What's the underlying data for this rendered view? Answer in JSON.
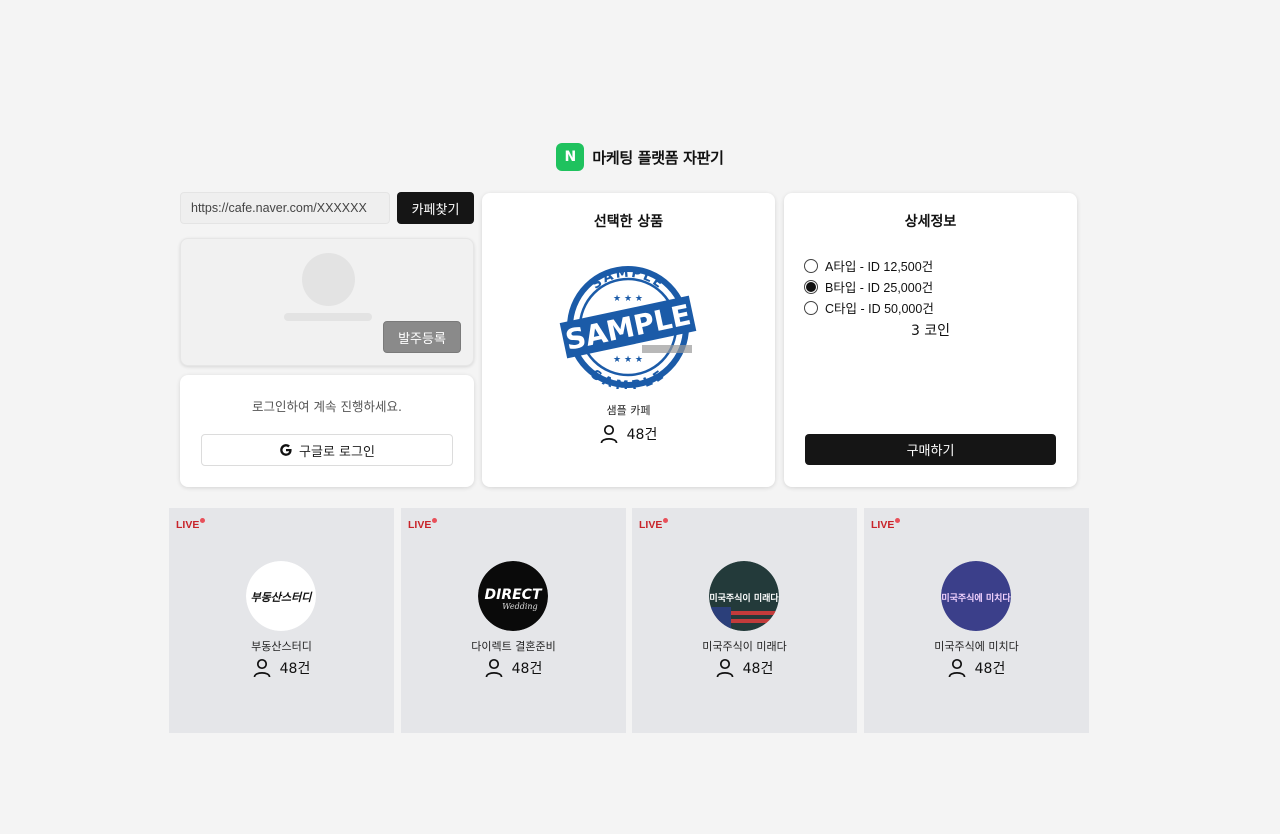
{
  "header": {
    "logo_letter": "N",
    "title": "마케팅 플랫폼 자판기",
    "logo_color": "#1fc25e"
  },
  "search": {
    "placeholder": "https://cafe.naver.com/XXXXXX",
    "button_label": "카페찾기"
  },
  "profile": {
    "order_button": "발주등록"
  },
  "login": {
    "message": "로그인하여 계속 진행하세요.",
    "google_button": "구글로 로그인"
  },
  "selected": {
    "title": "선택한 상품",
    "stamp_text": "SAMPLE",
    "cafe_name": "샘플 카페",
    "count": "48건"
  },
  "detail": {
    "title": "상세정보",
    "options": [
      {
        "label": "A타입 - ID 12,500건",
        "selected": false
      },
      {
        "label": "B타입 - ID 25,000건",
        "selected": true
      },
      {
        "label": "C타입 - ID 50,000건",
        "selected": false
      }
    ],
    "coin": "3 코인",
    "buy_button": "구매하기"
  },
  "live_cards": [
    {
      "badge": "LIVE",
      "name": "부동산스터디",
      "count": "48건",
      "avatar_text": "부동산스터디",
      "avatar_style": "light"
    },
    {
      "badge": "LIVE",
      "name": "다이렉트 결혼준비",
      "count": "48건",
      "avatar_text": "DIRECT",
      "avatar_sub": "Wedding",
      "avatar_style": "dark"
    },
    {
      "badge": "LIVE",
      "name": "미국주식이 미래다",
      "count": "48건",
      "avatar_text": "미국주식이 미래다",
      "avatar_style": "flag"
    },
    {
      "badge": "LIVE",
      "name": "미국주식에 미치다",
      "count": "48건",
      "avatar_text": "미국주식에 미치다",
      "avatar_style": "neon"
    }
  ],
  "colors": {
    "live_red": "#c8242a",
    "button_dark": "#151515",
    "stamp_blue": "#1b5ba8"
  }
}
